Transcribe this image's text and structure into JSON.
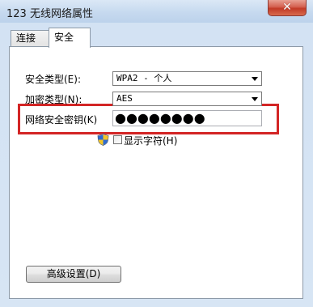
{
  "window": {
    "title": "123 无线网络属性",
    "close_glyph": "✕"
  },
  "tabs": [
    {
      "label": "连接"
    },
    {
      "label": "安全"
    }
  ],
  "security": {
    "security_type_label": "安全类型(E):",
    "security_type_value": "WPA2 - 个人",
    "encryption_type_label": "加密类型(N):",
    "encryption_type_value": "AES",
    "key_label": "网络安全密钥(K)",
    "key_value_masked": "●●●●●●●●",
    "show_chars_label": "显示字符(H)",
    "show_chars_checked": false,
    "advanced_button_label": "高级设置(D)"
  },
  "colors": {
    "highlight": "#d32525",
    "close_button": "#c23a26"
  }
}
